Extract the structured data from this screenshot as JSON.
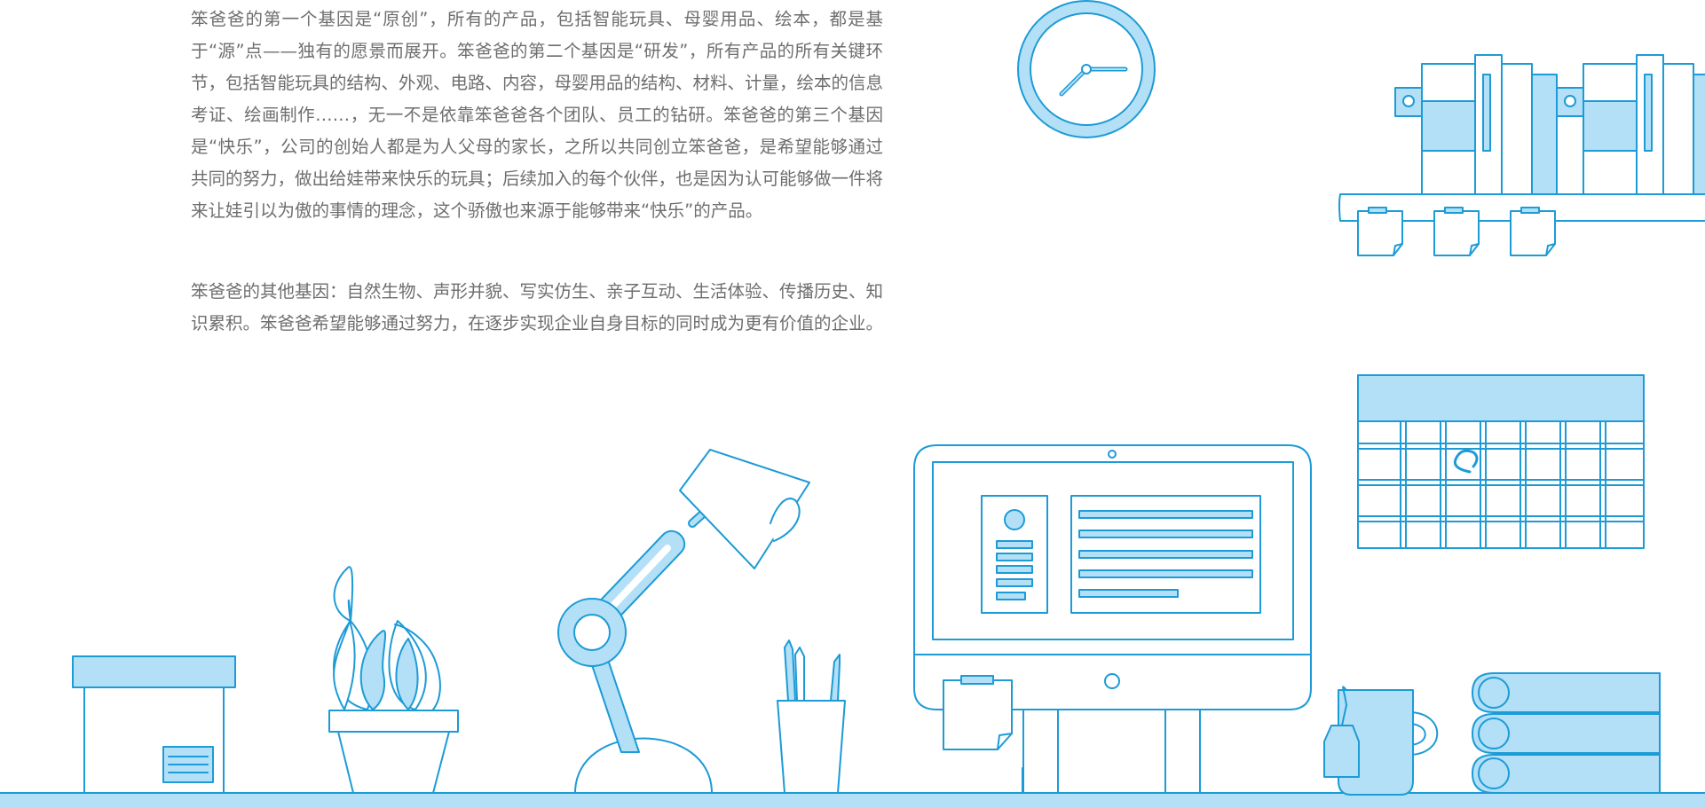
{
  "about": {
    "paragraph_1": "笨爸爸的第一个基因是“原创”，所有的产品，包括智能玩具、母婴用品、绘本，都是基于“源”点——独有的愿景而展开。笨爸爸的第二个基因是“研发”，所有产品的所有关键环节，包括智能玩具的结构、外观、电路、内容，母婴用品的结构、材料、计量，绘本的信息考证、绘画制作……，无一不是依靠笨爸爸各个团队、员工的钻研。笨爸爸的第三个基因是“快乐”，公司的创始人都是为人父母的家长，之所以共同创立笨爸爸，是希望能够通过共同的努力，做出给娃带来快乐的玩具；后续加入的每个伙伴，也是因为认可能够做一件将来让娃引以为傲的事情的理念，这个骄傲也来源于能够带来“快乐”的产品。",
    "paragraph_2": "笨爸爸的其他基因：自然生物、声形并貌、写实仿生、亲子互动、生活体验、传播历史、知识累积。笨爸爸希望能够通过努力，在逐步实现企业自身目标的同时成为更有价值的企业。"
  },
  "illustration": {
    "stroke_color": "#1d9bd6",
    "fill_color": "#b3e0f7",
    "background": "#ffffff",
    "items": [
      "wall-clock",
      "bookshelf",
      "sticky-notes",
      "calendar",
      "storage-box",
      "potted-plant",
      "desk-lamp",
      "pencil-cup",
      "computer-monitor",
      "sticky-note",
      "tea-mug",
      "book-stack",
      "desk-surface"
    ]
  }
}
